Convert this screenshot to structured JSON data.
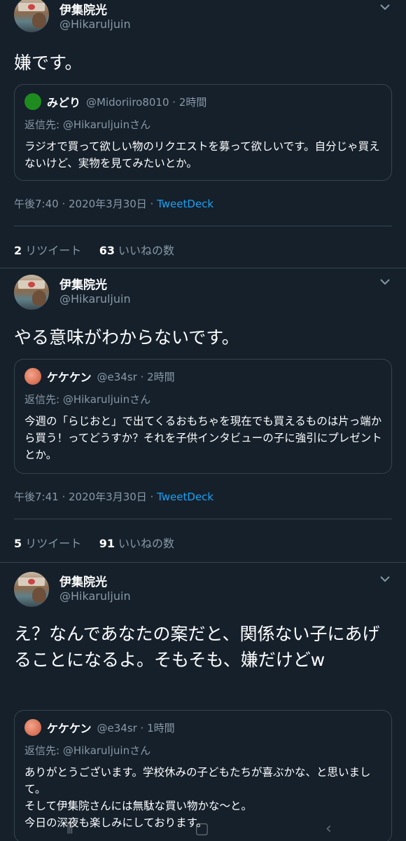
{
  "tweets": [
    {
      "name": "伊集院光",
      "handle": "@Hikaruljuin",
      "text": "嫌です。",
      "quote": {
        "name": "みどり",
        "meta": "@Midoriiro8010 · 2時間",
        "reply_to": "返信先: @Hikaruljuinさん",
        "text": "ラジオで買って欲しい物のリクエストを募って欲しいです。自分じゃ買えないけど、実物を見てみたいとか。",
        "avatar_color": "#1e8b1e"
      },
      "time": "午後7:40 · 2020年3月30日 · ",
      "source": "TweetDeck",
      "retweets": "2",
      "retweets_label": "リツイート",
      "likes": "63",
      "likes_label": "いいねの数"
    },
    {
      "name": "伊集院光",
      "handle": "@Hikaruljuin",
      "text": "やる意味がわからないです。",
      "quote": {
        "name": "ケケケン",
        "meta": "@e34sr · 2時間",
        "reply_to": "返信先: @Hikaruljuinさん",
        "text": "今週の「らじおと」で出てくるおもちゃを現在でも買えるものは片っ端から買う！ってどうすか？それを子供インタビューの子に強引にプレゼントとか。",
        "avatar_color": "#e0745a"
      },
      "time": "午後7:41 · 2020年3月30日 · ",
      "source": "TweetDeck",
      "retweets": "5",
      "retweets_label": "リツイート",
      "likes": "91",
      "likes_label": "いいねの数"
    },
    {
      "name": "伊集院光",
      "handle": "@Hikaruljuin",
      "text": "え？なんであなたの案だと、関係ない子にあげることになるよ。そもそも、嫌だけどw",
      "quote": {
        "name": "ケケケン",
        "meta": "@e34sr · 1時間",
        "reply_to": "返信先: @Hikaruljuinさん",
        "text": "ありがとうございます。学校休みの子どもたちが喜ぶかな、と思いまして。\nそして伊集院さんには無駄な買い物かな〜と。\n今日の深夜も楽しみにしております。",
        "avatar_color": "#e0745a"
      }
    }
  ],
  "nav": {
    "recent_icon": "recent-apps-icon",
    "home_icon": "home-icon",
    "back_icon": "back-icon"
  }
}
